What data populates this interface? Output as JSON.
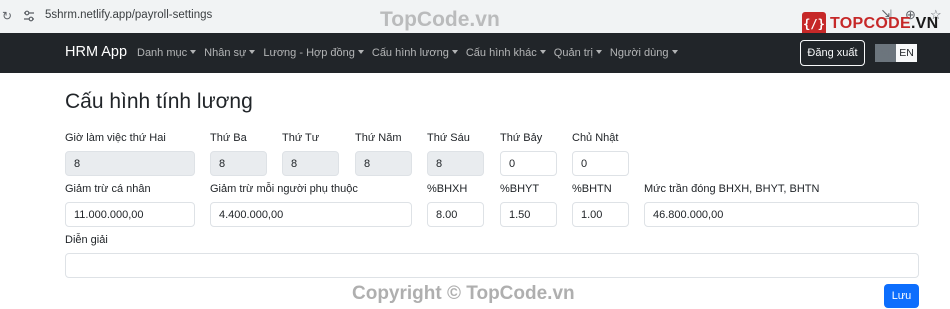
{
  "browser": {
    "url": "5shrm.netlify.app/payroll-settings"
  },
  "watermark": {
    "top_text": "TopCode.vn",
    "logo_badge": "{/}",
    "logo_text": "TOPCODE",
    "logo_suffix": ".VN",
    "bottom_text": "Copyright © TopCode.vn"
  },
  "navbar": {
    "brand": "HRM App",
    "items": [
      {
        "label": "Danh mục"
      },
      {
        "label": "Nhân sự"
      },
      {
        "label": "Lương - Hợp đồng"
      },
      {
        "label": "Cấu hình lương"
      },
      {
        "label": "Cấu hình khác"
      },
      {
        "label": "Quản trị"
      },
      {
        "label": "Người dùng"
      }
    ],
    "logout_label": "Đăng xuất",
    "lang": {
      "vi": "VI",
      "en": "EN"
    }
  },
  "page": {
    "title": "Cấu hình tính lương"
  },
  "workdays": [
    {
      "label": "Giờ làm việc thứ Hai",
      "value": "8",
      "disabled": true
    },
    {
      "label": "Thứ Ba",
      "value": "8",
      "disabled": true
    },
    {
      "label": "Thứ Tư",
      "value": "8",
      "disabled": true
    },
    {
      "label": "Thứ Năm",
      "value": "8",
      "disabled": true
    },
    {
      "label": "Thứ Sáu",
      "value": "8",
      "disabled": true
    },
    {
      "label": "Thứ Bảy",
      "value": "0",
      "disabled": false
    },
    {
      "label": "Chủ Nhật",
      "value": "0",
      "disabled": false
    }
  ],
  "deductions": [
    {
      "label": "Giảm trừ cá nhân",
      "value": "11.000.000,00"
    },
    {
      "label": "Giảm trừ mỗi người phụ thuộc",
      "value": "4.400.000,00"
    },
    {
      "label": "%BHXH",
      "value": "8.00"
    },
    {
      "label": "%BHYT",
      "value": "1.50"
    },
    {
      "label": "%BHTN",
      "value": "1.00"
    },
    {
      "label": "Mức trần đóng BHXH, BHYT, BHTN",
      "value": "46.800.000,00"
    }
  ],
  "description": {
    "label": "Diễn giải",
    "value": ""
  },
  "save_label": "Lưu",
  "colors": {
    "navbar_bg": "#212529",
    "primary": "#0d6efd",
    "disabled_field_bg": "#e9ecef"
  }
}
